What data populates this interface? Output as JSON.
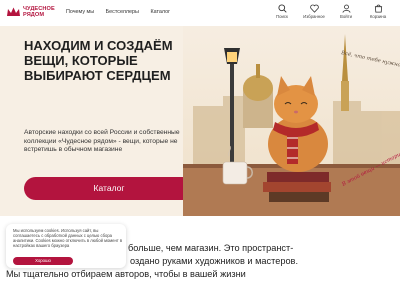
{
  "brand": {
    "name_line1": "ЧУДЕСНОЕ",
    "name_line2": "РЯДОМ",
    "color": "#b3143e"
  },
  "nav": {
    "items": [
      "Почему мы",
      "Бестселлеры",
      "Каталог"
    ]
  },
  "header_icons": [
    {
      "icon": "search-icon",
      "label": "Поиск"
    },
    {
      "icon": "heart-icon",
      "label": "Избранное"
    },
    {
      "icon": "user-icon",
      "label": "Войти"
    },
    {
      "icon": "cart-icon",
      "label": "Корзина"
    }
  ],
  "hero": {
    "title": "НАХОДИМ И СОЗДАЁМ ВЕЩИ, КОТОРЫЕ ВЫБИРАЮТ СЕРДЦЕМ",
    "description": "Авторские находки со всей России и собственные коллекции «Чудесное рядом» - вещи, которые не встретишь в обычном магазине",
    "button_label": "Каталог",
    "art_caption_1": "Всё, что тебе нужно, ",
    "art_caption_2": "В этой вещи — история"
  },
  "about": {
    "line1": "больше, чем магазин. Это пространст-",
    "line2": "оздано руками художников и мастеров.",
    "line3": "Мы тщательно отбираем авторов, чтобы в вашей жизни"
  },
  "cookie": {
    "text": "Мы используем cookies. Используя сайт, вы соглашаетесь с обработкой данных с целью сбора аналитики. Cookies можно отключить в любой момент в настройках вашего браузера",
    "button_label": "Хорошо"
  }
}
